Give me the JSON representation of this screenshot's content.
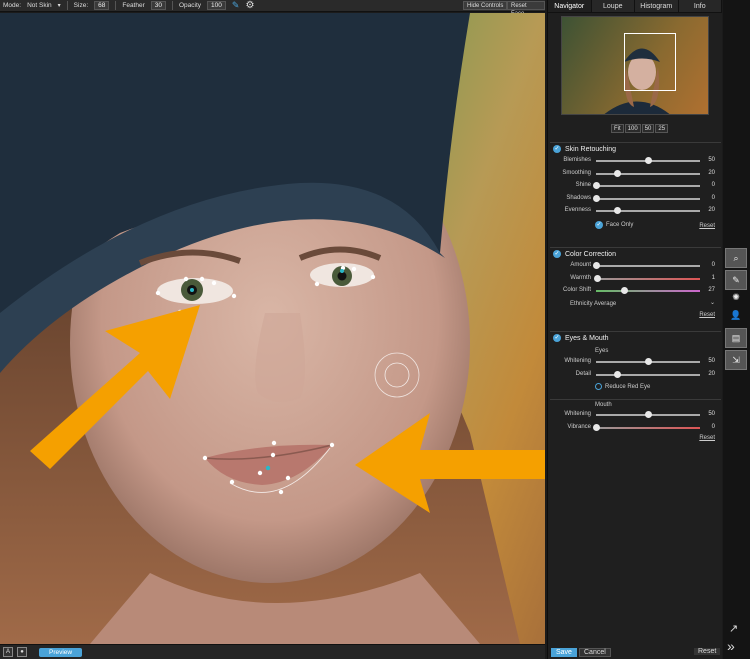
{
  "toolbar": {
    "mode_label": "Mode:",
    "mode_value": "Not Skin",
    "size_label": "Size:",
    "size_value": "68",
    "feather_label": "Feather",
    "feather_value": "30",
    "opacity_label": "Opacity",
    "opacity_value": "100",
    "hide_controls": "Hide Controls",
    "reset_face": "Reset Face"
  },
  "bottombar": {
    "icon_a": "A",
    "preview": "Preview"
  },
  "panel": {
    "tabs": [
      "Navigator",
      "Loupe",
      "Histogram",
      "Info"
    ],
    "zoom": [
      "Fit",
      "100",
      "50",
      "25"
    ],
    "skin": {
      "title": "Skin Retouching",
      "sliders": [
        {
          "label": "Blemishes",
          "value": 50
        },
        {
          "label": "Smoothing",
          "value": 20
        },
        {
          "label": "Shine",
          "value": 0
        },
        {
          "label": "Shadows",
          "value": 0
        },
        {
          "label": "Evenness",
          "value": 20
        }
      ],
      "face_only": "Face Only",
      "reset": "Reset"
    },
    "color": {
      "title": "Color Correction",
      "sliders": [
        {
          "label": "Amount",
          "value": 0
        },
        {
          "label": "Warmth",
          "value": 1
        },
        {
          "label": "Color Shift",
          "value": 27
        }
      ],
      "ethnicity_label": "Ethnicity",
      "ethnicity_value": "Average",
      "reset": "Reset"
    },
    "eyes": {
      "title": "Eyes & Mouth",
      "eyes_label": "Eyes",
      "eyes_sliders": [
        {
          "label": "Whitening",
          "value": 50
        },
        {
          "label": "Detail",
          "value": 20
        }
      ],
      "red_eye": "Reduce Red Eye",
      "mouth_label": "Mouth",
      "mouth_sliders": [
        {
          "label": "Whitening",
          "value": 50
        },
        {
          "label": "Vibrance",
          "value": 0
        }
      ],
      "reset": "Reset"
    },
    "save": "Save",
    "cancel": "Cancel",
    "reset": "Reset"
  },
  "colors": {
    "accent": "#4aa3d8",
    "arrow": "#f5a000"
  }
}
